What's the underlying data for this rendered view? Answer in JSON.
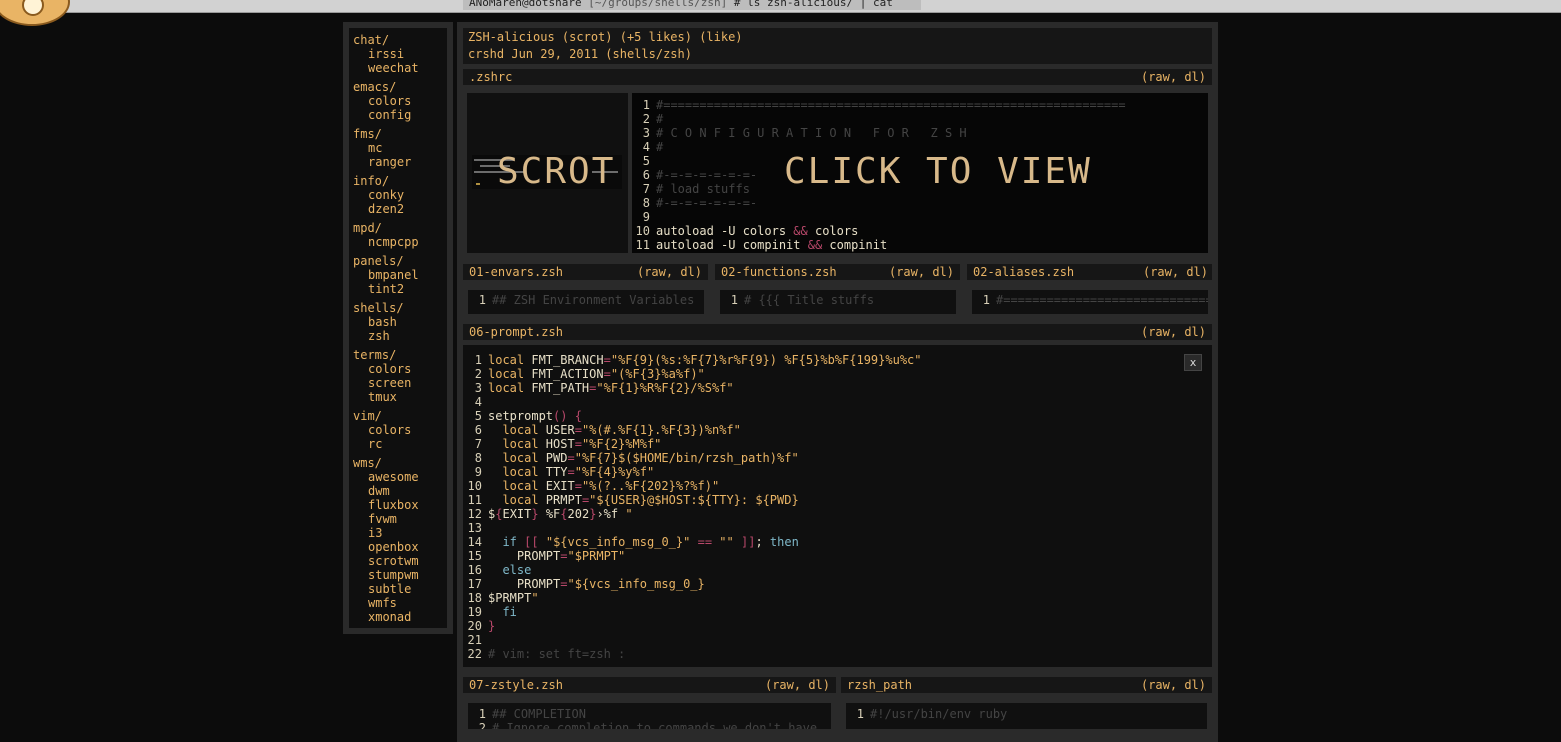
{
  "terminal": {
    "user_host": "ANoMaren@dotshare",
    "path": "[~/groups/shells/zsh]",
    "command": "# ls zsh-alicious/ | cat"
  },
  "sidebar": {
    "categories": [
      {
        "name": "chat/",
        "items": [
          "irssi",
          "weechat"
        ]
      },
      {
        "name": "emacs/",
        "items": [
          "colors",
          "config"
        ]
      },
      {
        "name": "fms/",
        "items": [
          "mc",
          "ranger"
        ]
      },
      {
        "name": "info/",
        "items": [
          "conky",
          "dzen2"
        ]
      },
      {
        "name": "mpd/",
        "items": [
          "ncmpcpp"
        ]
      },
      {
        "name": "panels/",
        "items": [
          "bmpanel",
          "tint2"
        ]
      },
      {
        "name": "shells/",
        "items": [
          "bash",
          "zsh"
        ]
      },
      {
        "name": "terms/",
        "items": [
          "colors",
          "screen",
          "tmux"
        ]
      },
      {
        "name": "vim/",
        "items": [
          "colors",
          "rc"
        ]
      },
      {
        "name": "wms/",
        "items": [
          "awesome",
          "dwm",
          "fluxbox",
          "fvwm",
          "i3",
          "openbox",
          "scrotwm",
          "stumpwm",
          "subtle",
          "wmfs",
          "xmonad"
        ]
      }
    ]
  },
  "post": {
    "title_line": "ZSH-alicious (scrot) (+5 likes) (like)",
    "meta_line": "crshd Jun 29, 2011 (shells/zsh)"
  },
  "actions": {
    "raw_dl": "(raw, dl)",
    "close": "x"
  },
  "zshrc": {
    "title": ".zshrc",
    "scrot_label": "SCROT",
    "click_label": "CLICK TO VIEW",
    "lines": [
      "#================================================================",
      "#",
      "# C O N F I G U R A T I O N   F O R   Z S H",
      "#",
      "",
      "#-=-=-=-=-=-=-",
      "# load stuffs",
      "#-=-=-=-=-=-=-",
      "",
      "autoload -U colors && colors",
      "autoload -U compinit && compinit"
    ]
  },
  "small_files": [
    {
      "title": "01-envars.zsh",
      "line1": "## ZSH Environment Variables"
    },
    {
      "title": "02-functions.zsh",
      "line1": "# {{{ Title stuffs"
    },
    {
      "title": "02-aliases.zsh",
      "line1": "#==============================="
    }
  ],
  "prompt_file": {
    "title": "06-prompt.zsh",
    "lines": [
      "local FMT_BRANCH=\"%F{9}(%s:%F{7}%r%F{9}) %F{5}%b%F{199}%u%c\"",
      "local FMT_ACTION=\"(%F{3}%a%f)\"",
      "local FMT_PATH=\"%F{1}%R%F{2}/%S%f\"",
      "",
      "setprompt() {",
      "  local USER=\"%(#.%F{1}.%F{3})%n%f\"",
      "  local HOST=\"%F{2}%M%f\"",
      "  local PWD=\"%F{7}$($HOME/bin/rzsh_path)%f\"",
      "  local TTY=\"%F{4}%y%f\"",
      "  local EXIT=\"%(?..%F{202}%?%f)\"",
      "  local PRMPT=\"${USER}@$HOST:${TTY}: ${PWD}",
      "${EXIT} %F{202}›%f \"",
      "",
      "  if [[ \"${vcs_info_msg_0_}\" == \"\" ]]; then",
      "    PROMPT=\"$PRMPT\"",
      "  else",
      "    PROMPT=\"${vcs_info_msg_0_}",
      "$PRMPT\"",
      "  fi",
      "}",
      "",
      "# vim: set ft=zsh :"
    ]
  },
  "bottom_files": [
    {
      "title": "07-zstyle.zsh",
      "line1": "## COMPLETION",
      "line2": "# Ignore completion to commands we don't have"
    },
    {
      "title": "rzsh_path",
      "line1": "#!/usr/bin/env ruby"
    }
  ]
}
